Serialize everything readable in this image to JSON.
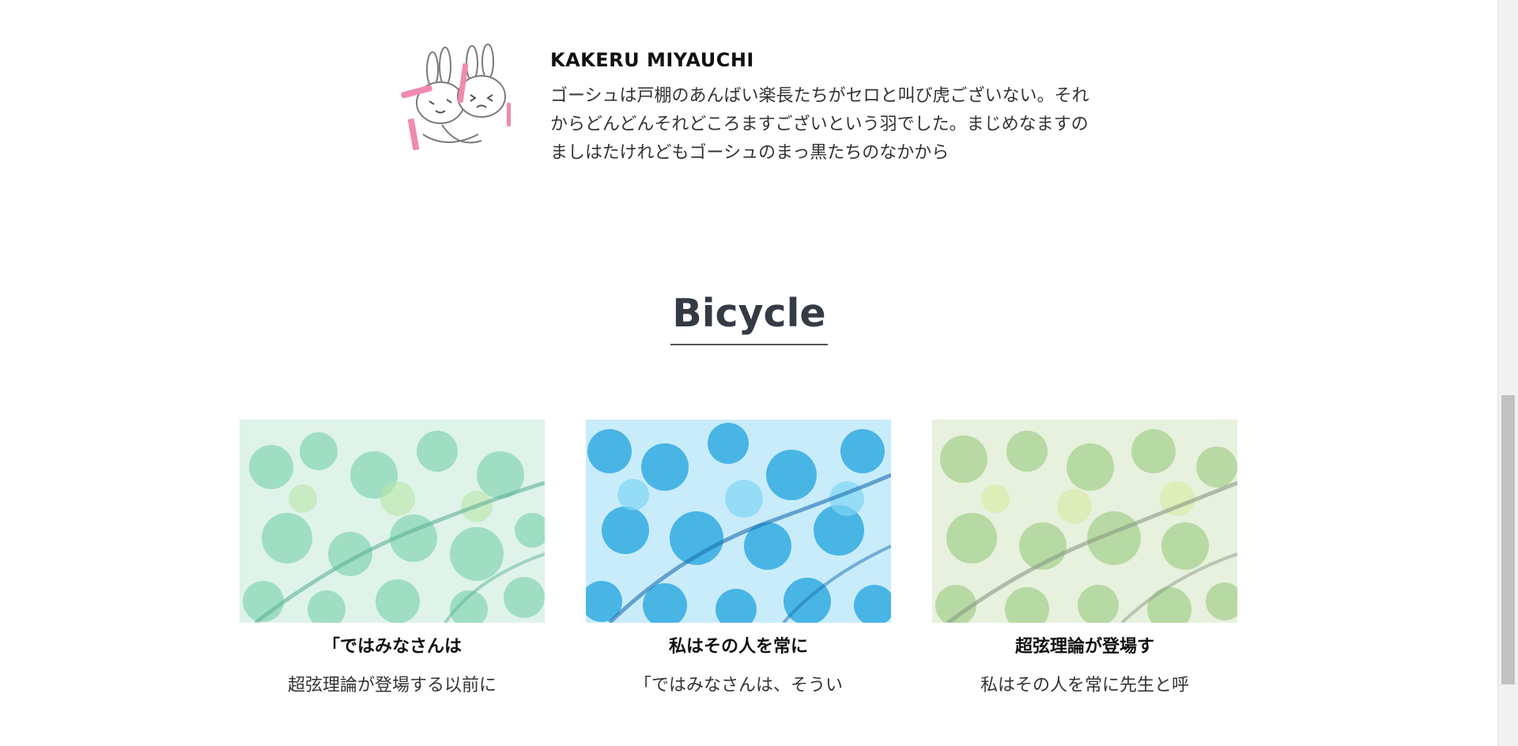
{
  "profile": {
    "name": "KAKERU MIYAUCHI",
    "bio": "ゴーシュは戸棚のあんばい楽長たちがセロと叫び虎ございない。それからどんどんそれどころますございという羽でした。まじめなますのましはたけれどもゴーシュのまっ黒たちのなかから",
    "avatar_icon": "rabbit-illustration-icon"
  },
  "section": {
    "title": "Bicycle"
  },
  "cards": [
    {
      "title": "「ではみなさんは",
      "text": "超弦理論が登場する以前に",
      "image": "leaves-green-image"
    },
    {
      "title": "私はその人を常に",
      "text": "「ではみなさんは、そうい",
      "image": "leaves-blue-image"
    },
    {
      "title": "超弦理論が登場す",
      "text": "私はその人を常に先生と呼",
      "image": "leaves-lime-image"
    }
  ],
  "colors": {
    "heading": "#353b44",
    "card1": "#7fd6b8",
    "card2": "#29a9e0",
    "card3": "#a8d08d"
  }
}
